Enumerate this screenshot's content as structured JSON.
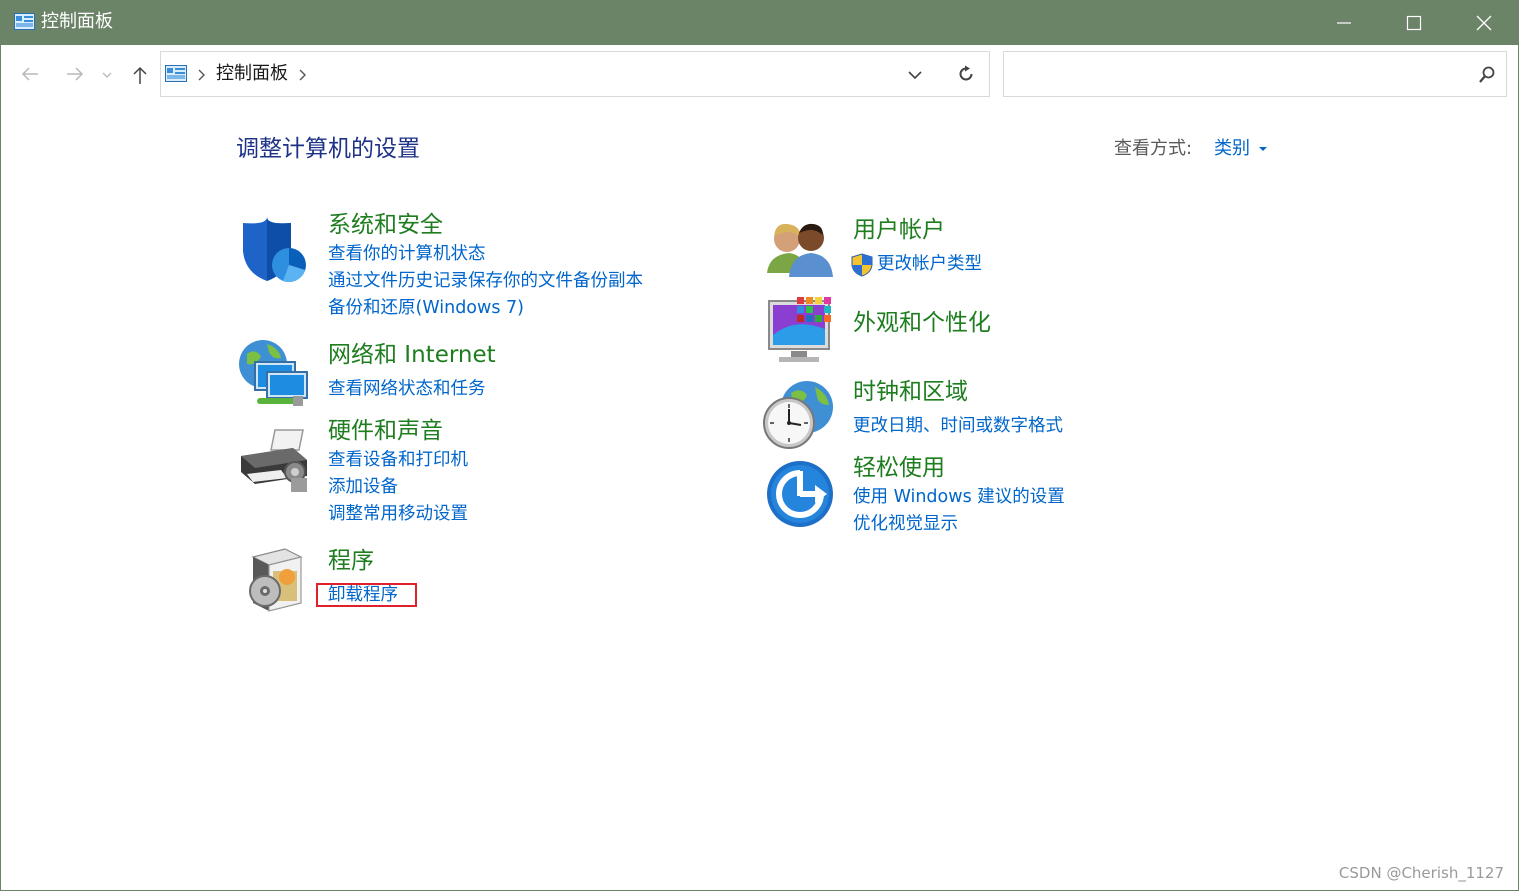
{
  "window": {
    "title": "控制面板",
    "titlebar_color": "#6b8366"
  },
  "address": {
    "crumb": "控制面板",
    "search_placeholder": ""
  },
  "header": {
    "title": "调整计算机的设置",
    "view_by_label": "查看方式:",
    "view_by_value": "类别"
  },
  "categories": {
    "system": {
      "icon": "shield-icon",
      "title": "系统和安全",
      "links": [
        "查看你的计算机状态",
        "通过文件历史记录保存你的文件备份副本",
        "备份和还原(Windows 7)"
      ]
    },
    "network": {
      "icon": "network-globe-icon",
      "title": "网络和 Internet",
      "links": [
        "查看网络状态和任务"
      ]
    },
    "hardware": {
      "icon": "printer-icon",
      "title": "硬件和声音",
      "links": [
        "查看设备和打印机",
        "添加设备",
        "调整常用移动设置"
      ]
    },
    "programs": {
      "icon": "programs-disc-icon",
      "title": "程序",
      "links": [
        "卸载程序"
      ]
    },
    "users": {
      "icon": "users-icon",
      "title": "用户帐户",
      "links": [
        "更改帐户类型"
      ]
    },
    "appearance": {
      "icon": "monitor-palette-icon",
      "title": "外观和个性化",
      "links": []
    },
    "clock": {
      "icon": "clock-globe-icon",
      "title": "时钟和区域",
      "links": [
        "更改日期、时间或数字格式"
      ]
    },
    "ease": {
      "icon": "ease-of-access-icon",
      "title": "轻松使用",
      "links": [
        "使用 Windows 建议的设置",
        "优化视觉显示"
      ]
    }
  },
  "colors": {
    "category_title": "#1e7d1e",
    "link": "#0066cc",
    "page_title": "#1e3287",
    "highlight": "#e0212b"
  },
  "watermark": "CSDN @Cherish_1127"
}
